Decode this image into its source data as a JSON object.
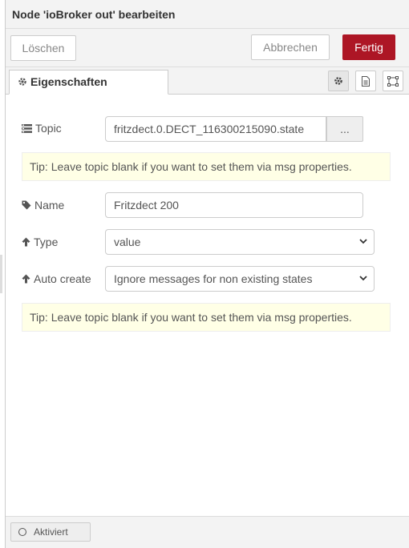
{
  "header": {
    "title": "Node 'ioBroker out' bearbeiten"
  },
  "toolbar": {
    "delete_label": "Löschen",
    "cancel_label": "Abbrechen",
    "done_label": "Fertig",
    "done_color": "#ad1625"
  },
  "tabs": {
    "properties_label": "Eigenschaften",
    "icons": [
      "gear-icon",
      "description-icon",
      "appearance-icon"
    ]
  },
  "form": {
    "topic_label": "Topic",
    "topic_value": "fritzdect.0.DECT_116300215090.state",
    "topic_browse_label": "...",
    "tip1": "Tip: Leave topic blank if you want to set them via msg properties.",
    "name_label": "Name",
    "name_value": "Fritzdect 200",
    "type_label": "Type",
    "type_value": "value",
    "autocreate_label": "Auto create",
    "autocreate_value": "Ignore messages for non existing states",
    "tip2": "Tip: Leave topic blank if you want to set them via msg properties."
  },
  "footer": {
    "enabled_label": "Aktiviert"
  }
}
